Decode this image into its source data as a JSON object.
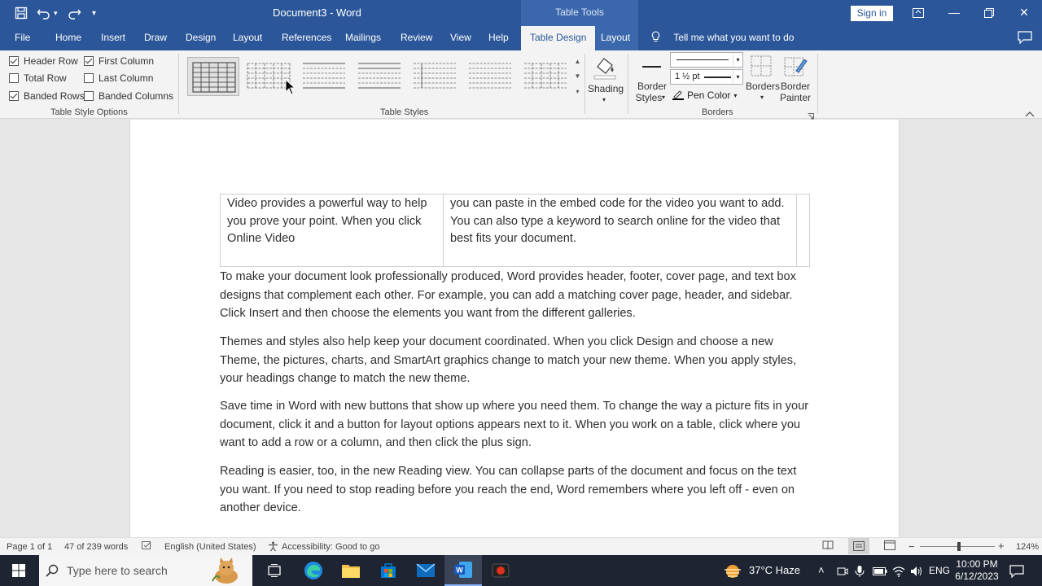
{
  "titlebar": {
    "doc_title": "Document3  -  Word",
    "contextual_header": "Table Tools",
    "signin_label": "Sign in"
  },
  "tabs": {
    "file": "File",
    "home": "Home",
    "insert": "Insert",
    "draw": "Draw",
    "design": "Design",
    "layout": "Layout",
    "references": "References",
    "mailings": "Mailings",
    "review": "Review",
    "view": "View",
    "help": "Help",
    "table_design": "Table Design",
    "table_layout": "Layout",
    "tell_me": "Tell me what you want to do"
  },
  "ribbon": {
    "options": {
      "header_row": {
        "label": "Header Row",
        "checked": true
      },
      "first_column": {
        "label": "First Column",
        "checked": true
      },
      "total_row": {
        "label": "Total Row",
        "checked": false
      },
      "last_column": {
        "label": "Last Column",
        "checked": false
      },
      "banded_rows": {
        "label": "Banded Rows",
        "checked": true
      },
      "banded_columns": {
        "label": "Banded Columns",
        "checked": false
      }
    },
    "group_table_style_options": "Table Style Options",
    "group_table_styles": "Table Styles",
    "group_borders": "Borders",
    "shading": "Shading",
    "border_styles_line1": "Border",
    "border_styles_line2": "Styles",
    "pen_weight": "1 ½ pt",
    "pen_color": "Pen Color",
    "borders": "Borders",
    "border_painter_line1": "Border",
    "border_painter_line2": "Painter"
  },
  "document": {
    "table_cell_1": "Video provides a powerful way to help you prove your point. When you click Online Video",
    "table_cell_2": "you can paste in the embed code for the video you want to add. You can also type a keyword to search online for the video that best fits your document.",
    "paragraphs": [
      "To make your document look professionally produced, Word provides header, footer, cover page, and text box designs that complement each other. For example, you can add a matching cover page, header, and sidebar. Click Insert and then choose the elements you want from the different galleries.",
      "Themes and styles also help keep your document coordinated. When you click Design and choose a new Theme, the pictures, charts, and SmartArt graphics change to match your new theme. When you apply styles, your headings change to match the new theme.",
      "Save time in Word with new buttons that show up where you need them. To change the way a picture fits in your document, click it and a button for layout options appears next to it. When you work on a table, click where you want to add a row or a column, and then click the plus sign.",
      "Reading is easier, too, in the new Reading view. You can collapse parts of the document and focus on the text you want. If you need to stop reading before you reach the end, Word remembers where you left off - even on another device."
    ]
  },
  "statusbar": {
    "page": "Page 1 of 1",
    "words": "47 of 239 words",
    "language": "English (United States)",
    "accessibility": "Accessibility: Good to go",
    "zoom": "124%"
  },
  "taskbar": {
    "search_placeholder": "Type here to search",
    "weather": "37°C  Haze",
    "lang": "ENG",
    "time": "10:00 PM",
    "date": "6/12/2023"
  },
  "colors": {
    "accent": "#2b579a",
    "contextual": "#3b68ad",
    "taskbar": "#1f2433"
  }
}
